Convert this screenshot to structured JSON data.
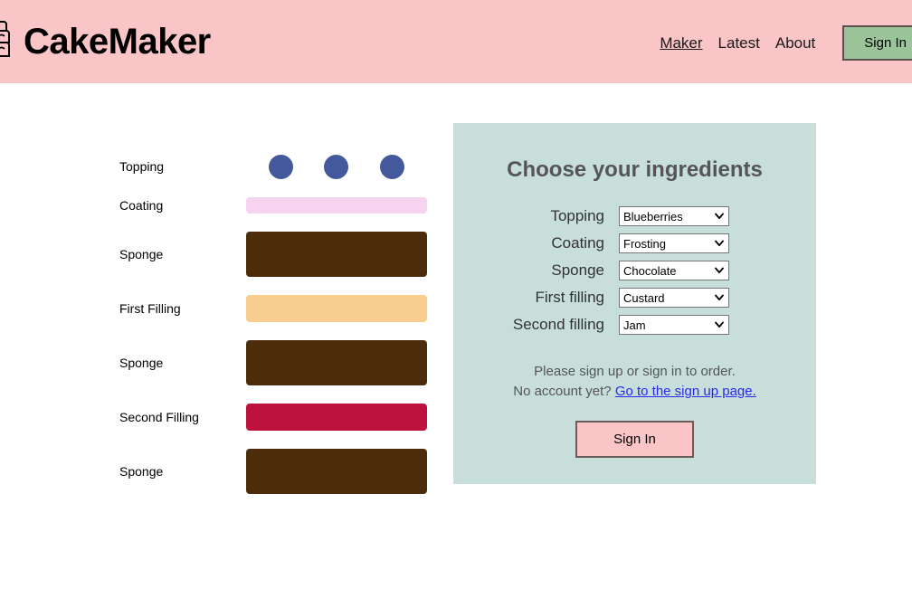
{
  "header": {
    "brand": "CakeMaker",
    "logo_icon": "cake-icon",
    "nav": [
      {
        "label": "Maker",
        "active": true
      },
      {
        "label": "Latest",
        "active": false
      },
      {
        "label": "About",
        "active": false
      }
    ],
    "signin_label": "Sign In",
    "background_color": "#f9c5c7",
    "signin_color": "#9bc49b"
  },
  "cake": {
    "layers": [
      {
        "label": "Topping",
        "kind": "dots",
        "color": "#43599c",
        "height": 28,
        "count": 3
      },
      {
        "label": "Coating",
        "kind": "bar",
        "color": "#f6d4ef",
        "height": 18
      },
      {
        "label": "Sponge",
        "kind": "bar",
        "color": "#4d2c0c",
        "height": 50
      },
      {
        "label": "First Filling",
        "kind": "bar",
        "color": "#f8cd8d",
        "height": 30
      },
      {
        "label": "Sponge",
        "kind": "bar",
        "color": "#4d2c0c",
        "height": 50
      },
      {
        "label": "Second Filling",
        "kind": "bar",
        "color": "#bd123e",
        "height": 30
      },
      {
        "label": "Sponge",
        "kind": "bar",
        "color": "#4d2c0c",
        "height": 50
      }
    ]
  },
  "panel": {
    "title": "Choose your ingredients",
    "background_color": "#c7dedb",
    "fields": [
      {
        "label": "Topping",
        "value": "Blueberries",
        "options": [
          "Blueberries"
        ]
      },
      {
        "label": "Coating",
        "value": "Frosting",
        "options": [
          "Frosting"
        ]
      },
      {
        "label": "Sponge",
        "value": "Chocolate",
        "options": [
          "Chocolate"
        ]
      },
      {
        "label": "First filling",
        "value": "Custard",
        "options": [
          "Custard"
        ]
      },
      {
        "label": "Second filling",
        "value": "Jam",
        "options": [
          "Jam"
        ]
      }
    ],
    "note_line1": "Please sign up or sign in to order.",
    "note_line2_prefix": "No account yet?",
    "note_link": "Go to the sign up page.",
    "signin_label": "Sign In",
    "signin_color": "#f9c5c7"
  }
}
